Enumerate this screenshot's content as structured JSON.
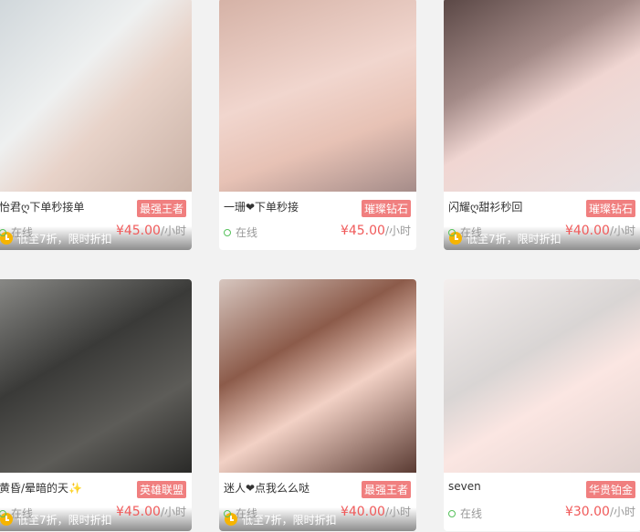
{
  "cards": [
    {
      "name": "怡君ღ下单秒接单",
      "rank": "最强王者",
      "discount": "低至7折，限时折扣",
      "status": "在线",
      "price": "¥45.00",
      "unit": "/小时",
      "photo": "woman-portrait"
    },
    {
      "name": "一珊❤下单秒接",
      "rank": "璀璨钻石",
      "discount": "",
      "status": "在线",
      "price": "¥45.00",
      "unit": "/小时",
      "photo": "woman-portrait"
    },
    {
      "name": "闪耀ღ甜衫秒回",
      "rank": "璀璨钻石",
      "discount": "低至7折，限时折扣",
      "status": "在线",
      "price": "¥40.00",
      "unit": "/小时",
      "photo": "woman-portrait"
    },
    {
      "name": "黄昏/晕暗的天✨",
      "rank": "英雄联盟",
      "discount": "低至7折，限时折扣",
      "status": "在线",
      "price": "¥45.00",
      "unit": "/小时",
      "photo": "man-portrait"
    },
    {
      "name": "迷人❤点我么么哒",
      "rank": "最强王者",
      "discount": "低至7折，限时折扣",
      "status": "在线",
      "price": "¥40.00",
      "unit": "/小时",
      "photo": "woman-portrait"
    },
    {
      "name": "seven",
      "rank": "华贵铂金",
      "discount": "",
      "status": "在线",
      "price": "¥30.00",
      "unit": "/小时",
      "photo": "woman-portrait"
    }
  ],
  "colors": {
    "rank_bg": "#f07f7f",
    "price": "#f05a5a",
    "online_dot": "#56c15b",
    "discount_icon": "#f6b400"
  }
}
